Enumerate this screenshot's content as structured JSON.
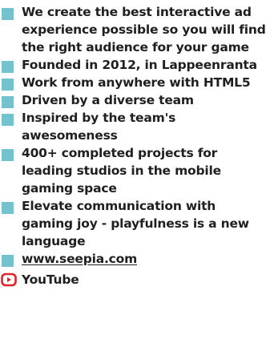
{
  "features": [
    "We create the best interactive ad experience possible so you will find the right audience for your game",
    "Founded in 2012, in Lappeenranta",
    "Work from anywhere with HTML5",
    "Driven by a diverse team",
    "Inspired by the team's awesomeness",
    "400+ completed projects for leading studios in the mobile gaming space",
    "Elevate communication with gaming joy - playfulness is a new language"
  ],
  "website": {
    "label": "www.seepia.com"
  },
  "youtube": {
    "label": "YouTube"
  },
  "colors": {
    "bullet": "#74c2cf",
    "youtube": "#e02323",
    "text": "#1f1f1f"
  }
}
